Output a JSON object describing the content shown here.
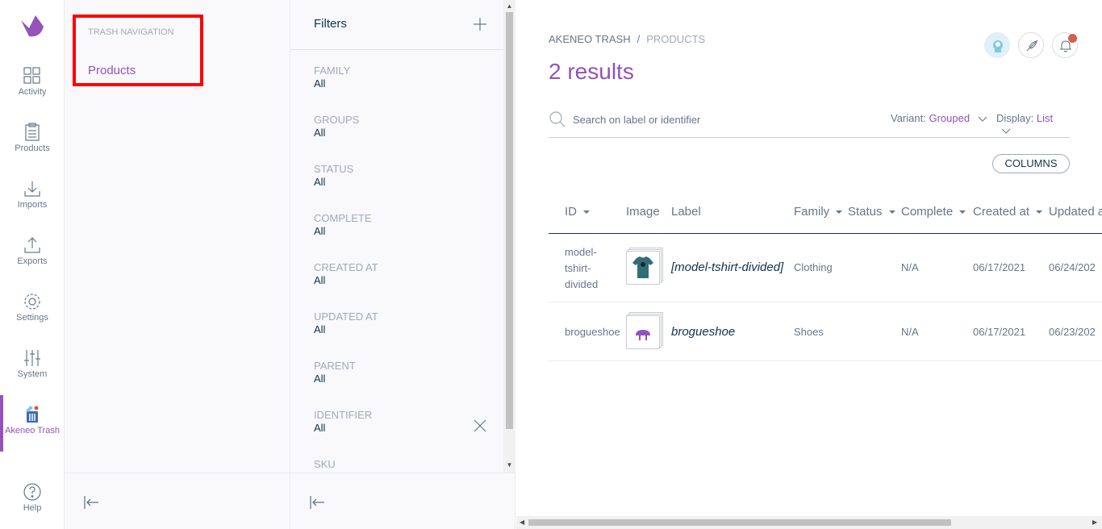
{
  "colors": {
    "accent": "#9452ba",
    "text_dark": "#11324d",
    "text": "#67768a",
    "muted": "#a1a9b7",
    "highlight": "#ff0000",
    "notification": "#d4604f"
  },
  "menu": {
    "items": [
      {
        "label": "Activity",
        "icon": "activity-icon"
      },
      {
        "label": "Products",
        "icon": "products-icon"
      },
      {
        "label": "Imports",
        "icon": "imports-icon"
      },
      {
        "label": "Exports",
        "icon": "exports-icon"
      },
      {
        "label": "Settings",
        "icon": "settings-icon"
      },
      {
        "label": "System",
        "icon": "system-icon"
      },
      {
        "label": "Akeneo Trash",
        "icon": "trash-icon",
        "active": true
      }
    ],
    "help": {
      "label": "Help",
      "icon": "help-icon"
    }
  },
  "nav": {
    "title": "TRASH NAVIGATION",
    "products": "Products"
  },
  "filters": {
    "title": "Filters",
    "items": [
      {
        "label": "FAMILY",
        "value": "All"
      },
      {
        "label": "GROUPS",
        "value": "All"
      },
      {
        "label": "STATUS",
        "value": "All"
      },
      {
        "label": "COMPLETE",
        "value": "All"
      },
      {
        "label": "CREATED AT",
        "value": "All"
      },
      {
        "label": "UPDATED AT",
        "value": "All"
      },
      {
        "label": "PARENT",
        "value": "All"
      },
      {
        "label": "IDENTIFIER",
        "value": "All"
      },
      {
        "label": "SKU",
        "value": ""
      }
    ]
  },
  "main": {
    "breadcrumb": {
      "root": "AKENEO TRASH",
      "separator": "/",
      "current": "PRODUCTS"
    },
    "results": "2 results",
    "search": {
      "placeholder": "Search on label or identifier",
      "value": ""
    },
    "variant": {
      "label": "Variant:",
      "value": "Grouped"
    },
    "display": {
      "label": "Display:",
      "value": "List"
    },
    "columns_button": "COLUMNS",
    "table": {
      "headers": [
        "ID",
        "Image",
        "Label",
        "Family",
        "Status",
        "Complete",
        "Created at",
        "Updated a"
      ],
      "rows": [
        {
          "id_lines": [
            "model-",
            "tshirt-",
            "divided"
          ],
          "label": "[model-tshirt-divided]",
          "family": "Clothing",
          "status": "",
          "complete": "N/A",
          "created": "06/17/2021",
          "updated": "06/24/202",
          "image": "tshirt-thumbnail"
        },
        {
          "id_lines": [
            "brogueshoe"
          ],
          "label": "brogueshoe",
          "family": "Shoes",
          "status": "",
          "complete": "N/A",
          "created": "06/17/2021",
          "updated": "06/23/202",
          "image": "shoe-thumbnail"
        }
      ]
    }
  }
}
